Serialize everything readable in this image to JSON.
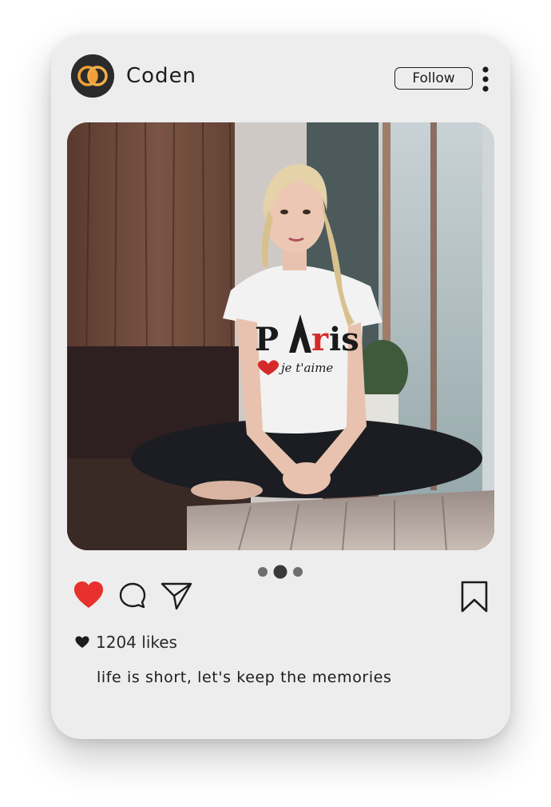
{
  "post": {
    "username": "Coden",
    "follow_label": "Follow",
    "likes": "1204 likes",
    "caption": "life is short, let's keep the memories",
    "carousel": {
      "count": 3,
      "active_index": 1
    },
    "liked": true,
    "photo_shirt_text": {
      "main": "PAris",
      "sub": "je t'aime"
    }
  },
  "icons": {
    "avatar": "logo-rings",
    "more": "kebab-vertical-icon",
    "like": "heart-icon",
    "comment": "comment-icon",
    "share": "send-icon",
    "save": "bookmark-icon"
  },
  "colors": {
    "card_bg": "#ededed",
    "like_red": "#e8302c",
    "avatar_orange": "#f0a038",
    "text": "#1c1c1c"
  }
}
